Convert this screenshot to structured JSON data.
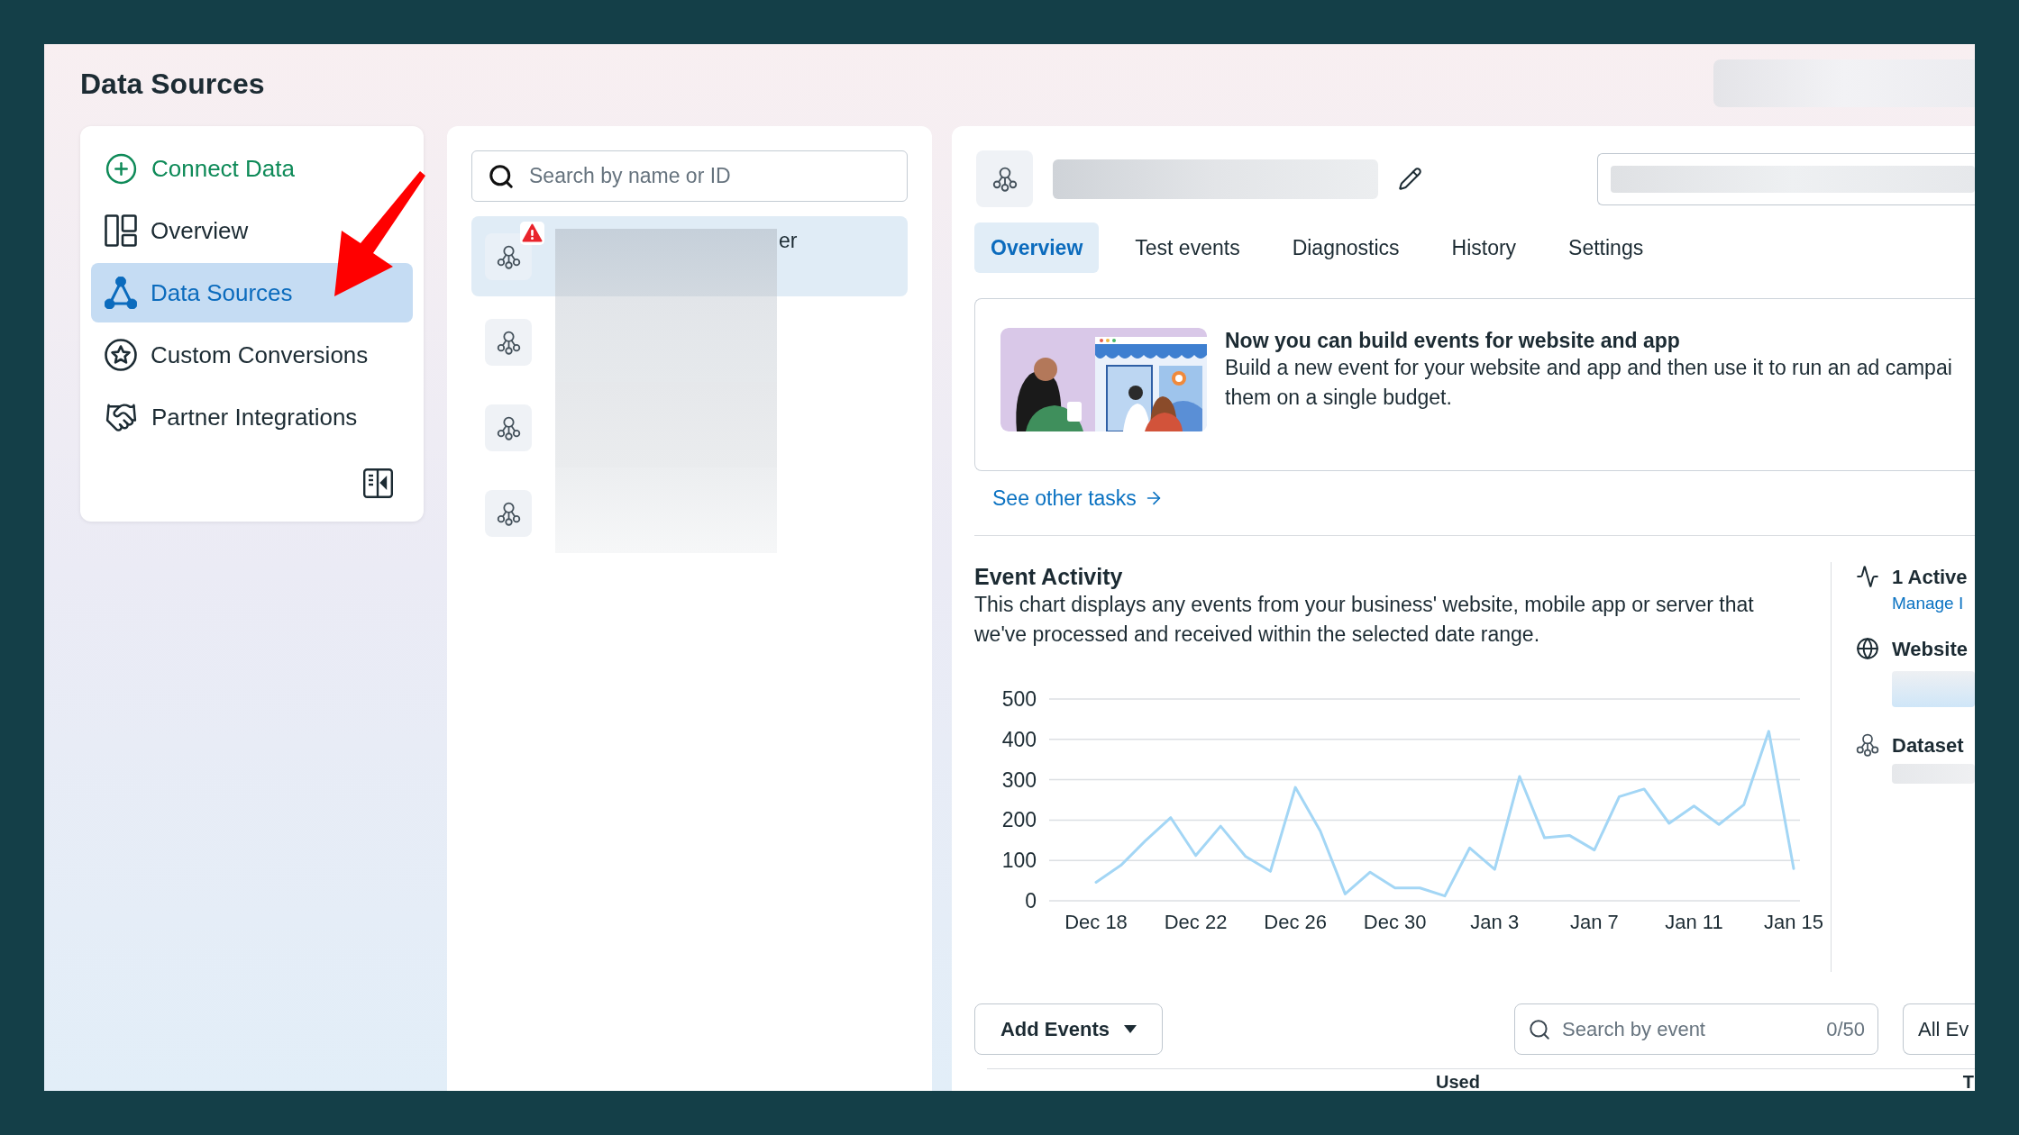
{
  "page": {
    "title": "Data Sources"
  },
  "sidebar": {
    "items": [
      {
        "label": "Connect Data",
        "kind": "action",
        "selected": false
      },
      {
        "label": "Overview",
        "kind": "nav",
        "selected": false
      },
      {
        "label": "Data Sources",
        "kind": "nav",
        "selected": true
      },
      {
        "label": "Custom Conversions",
        "kind": "nav",
        "selected": false
      },
      {
        "label": "Partner Integrations",
        "kind": "nav",
        "selected": false
      }
    ]
  },
  "source_list": {
    "search": {
      "placeholder": "Search by name or ID"
    },
    "items": [
      {
        "selected": true,
        "warning": true,
        "name": "er"
      },
      {
        "selected": false,
        "warning": false
      },
      {
        "selected": false,
        "warning": false
      },
      {
        "selected": false,
        "warning": false
      }
    ]
  },
  "detail": {
    "tabs": [
      {
        "label": "Overview",
        "selected": true
      },
      {
        "label": "Test events",
        "selected": false
      },
      {
        "label": "Diagnostics",
        "selected": false
      },
      {
        "label": "History",
        "selected": false
      },
      {
        "label": "Settings",
        "selected": false
      }
    ],
    "promo": {
      "title": "Now you can build events for website and app",
      "lines": [
        "Build a new event for your website and app and then use it to run an ad campai",
        "them on a single budget."
      ]
    },
    "tasks_link": "See other tasks",
    "activity": {
      "title": "Event Activity",
      "description": "This chart displays any events from your business' website, mobile app or server that we've processed and received within the selected date range.",
      "chart_data": {
        "type": "line",
        "grid": true,
        "categories": [
          "Dec 18",
          null,
          null,
          null,
          "Dec 22",
          null,
          null,
          null,
          "Dec 26",
          null,
          null,
          null,
          "Dec 30",
          null,
          null,
          null,
          "Jan 3",
          null,
          null,
          null,
          "Jan 7",
          null,
          null,
          null,
          "Jan 11",
          null,
          null,
          null,
          "Jan 15"
        ],
        "ylim": [
          0,
          500
        ],
        "yticks": [
          0,
          100,
          200,
          300,
          400,
          500
        ],
        "values": [
          46,
          88,
          150,
          206,
          112,
          185,
          110,
          73,
          281,
          173,
          17,
          71,
          32,
          32,
          12,
          131,
          78,
          308,
          156,
          162,
          126,
          258,
          277,
          192,
          235,
          189,
          238,
          420,
          80
        ]
      }
    },
    "summary": [
      {
        "kind": "active",
        "title": "1 Active",
        "link": "Manage I"
      },
      {
        "kind": "website",
        "title": "Website"
      },
      {
        "kind": "dataset",
        "title": "Dataset"
      }
    ],
    "events_toolbar": {
      "add_button": "Add Events",
      "search": {
        "placeholder": "Search by event",
        "count": "0/50"
      },
      "filter_button": "All Ev"
    },
    "table": {
      "columns": [
        "Used",
        "T"
      ]
    }
  }
}
